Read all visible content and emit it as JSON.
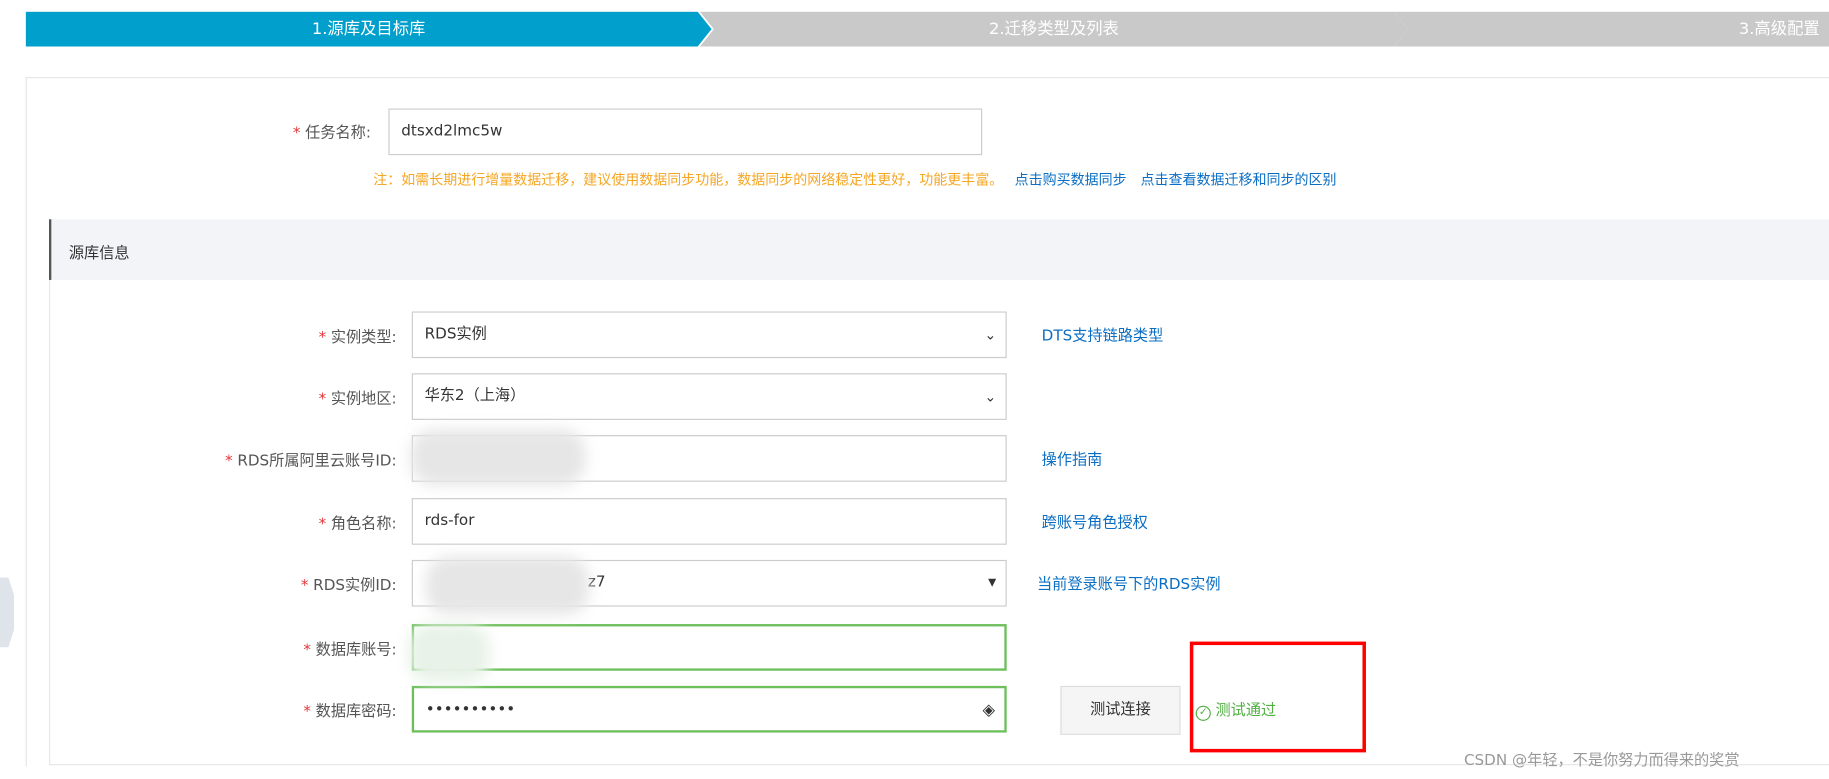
{
  "steps": [
    {
      "label": "1.源库及目标库",
      "active": true
    },
    {
      "label": "2.迁移类型及列表",
      "active": false
    },
    {
      "label": "3.高级配置",
      "active": false
    }
  ],
  "colors": {
    "active_step": "#009fcc",
    "inactive_step": "#c9c9c9",
    "required": "#e4393c",
    "note": "#f5a623",
    "link": "#0a6ec4",
    "success": "#52b043",
    "highlight_box": "#ff0000"
  },
  "task": {
    "required": "*",
    "label": "任务名称:",
    "value": "dtsxd2lmc5w"
  },
  "note": {
    "text": "注：如需长期进行增量数据迁移，建议使用数据同步功能，数据同步的网络稳定性更好，功能更丰富。",
    "link1": "点击购买数据同步",
    "link2": "点击查看数据迁移和同步的区别"
  },
  "section": {
    "title": "源库信息"
  },
  "rows": [
    {
      "required": "*",
      "label": "实例类型:",
      "value": "RDS实例",
      "control": "select",
      "link": "DTS支持链路类型"
    },
    {
      "required": "*",
      "label": "实例地区:",
      "value": "华东2（上海）",
      "control": "select",
      "link": ""
    },
    {
      "required": "*",
      "label": "RDS所属阿里云账号ID:",
      "value": "",
      "control": "input",
      "link": "操作指南"
    },
    {
      "required": "*",
      "label": "角色名称:",
      "value": "rds-for",
      "control": "input",
      "link": "跨账号角色授权"
    },
    {
      "required": "*",
      "label": "RDS实例ID:",
      "value": "z7",
      "control": "combo",
      "link": "当前登录账号下的RDS实例"
    },
    {
      "required": "*",
      "label": "数据库账号:",
      "value": "",
      "control": "input",
      "link": ""
    },
    {
      "required": "*",
      "label": "数据库密码:",
      "value": "••••••••••",
      "control": "password",
      "link": ""
    }
  ],
  "test": {
    "button": "测试连接",
    "result": "测试通过",
    "icon": "check-circle-icon"
  },
  "watermark": "CSDN @年轻，不是你努力而得来的奖赏"
}
